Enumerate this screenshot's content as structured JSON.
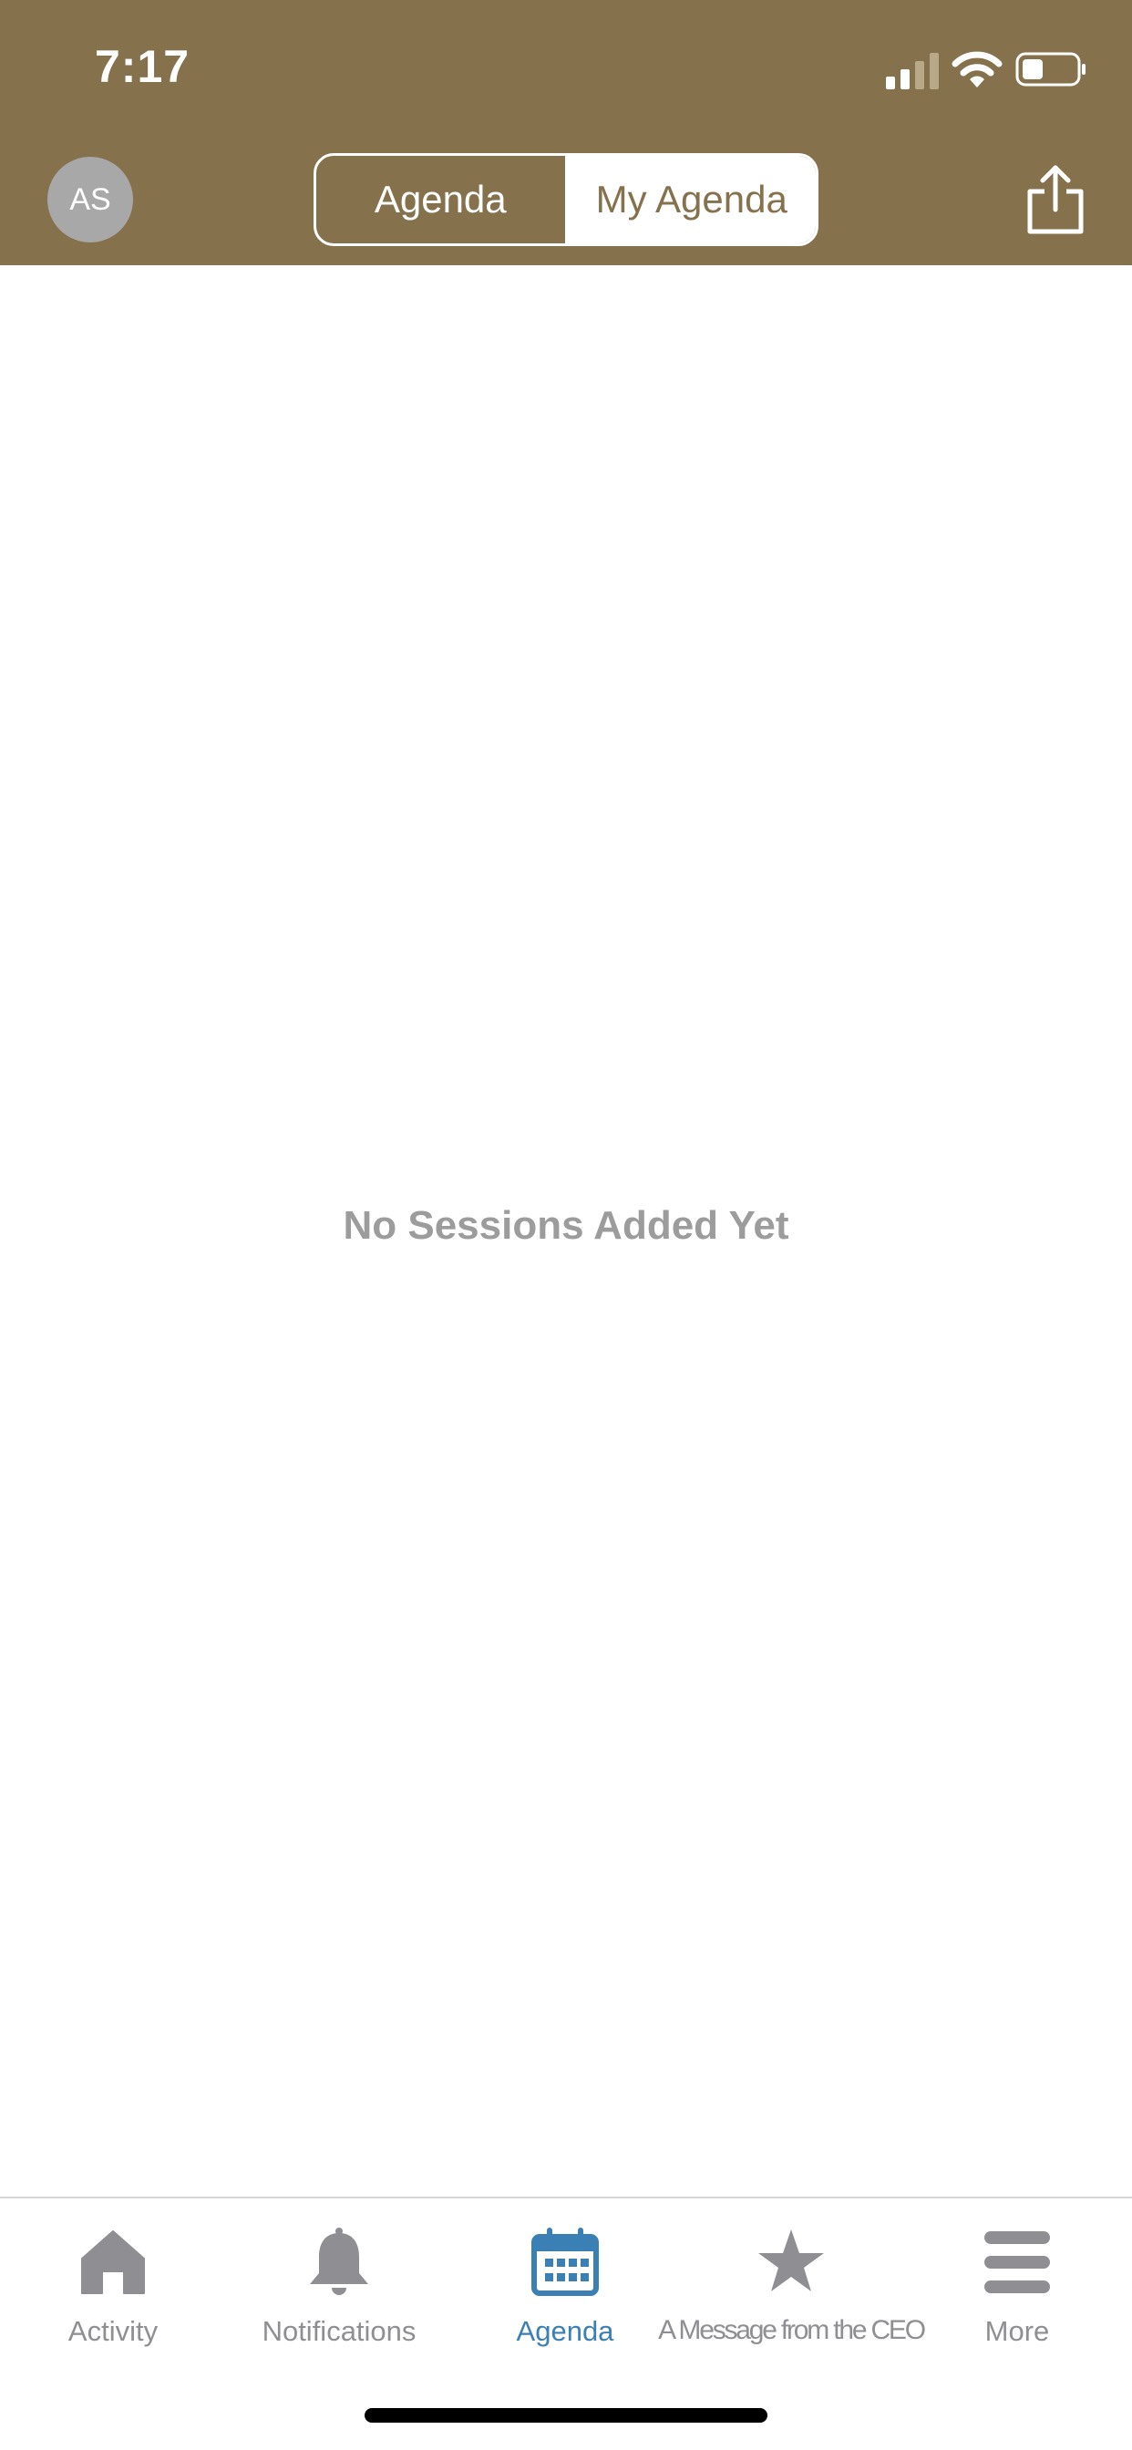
{
  "status_bar": {
    "time": "7:17"
  },
  "header": {
    "avatar_initials": "AS",
    "segments": [
      {
        "label": "Agenda",
        "selected": false
      },
      {
        "label": "My Agenda",
        "selected": true
      }
    ],
    "share_icon": "share-icon"
  },
  "main": {
    "empty_message": "No Sessions Added Yet"
  },
  "tab_bar": {
    "tabs": [
      {
        "label": "Activity",
        "icon": "home-icon",
        "active": false
      },
      {
        "label": "Notifications",
        "icon": "bell-icon",
        "active": false
      },
      {
        "label": "Agenda",
        "icon": "calendar-icon",
        "active": true
      },
      {
        "label": "A Message from the CEO",
        "icon": "star-icon",
        "active": false
      },
      {
        "label": "More",
        "icon": "menu-icon",
        "active": false
      }
    ]
  },
  "colors": {
    "header_bg": "#86714d",
    "active_tab": "#3a80b4",
    "inactive_tab": "#8e8e93",
    "empty_text": "#9c9c9c"
  }
}
